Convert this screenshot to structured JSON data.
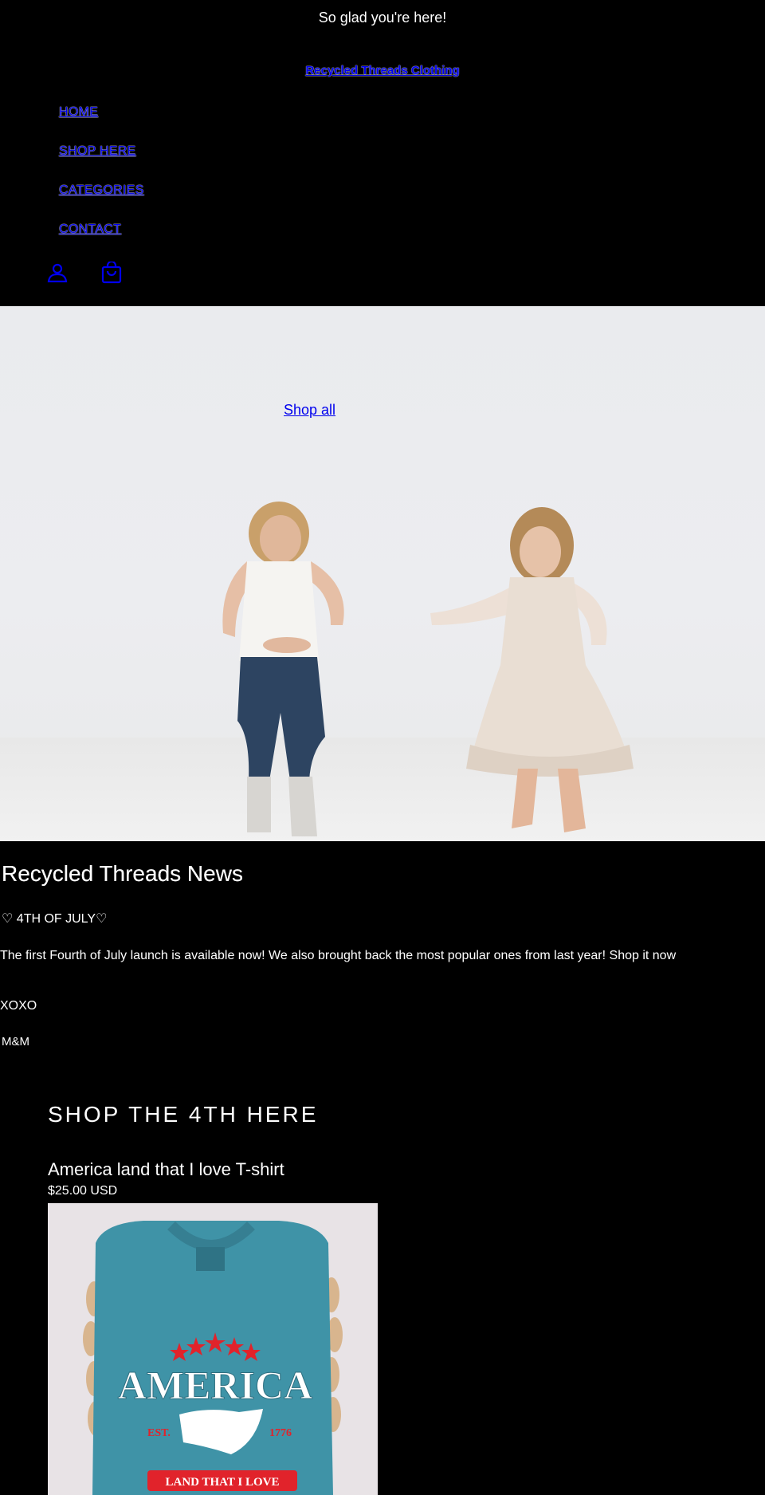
{
  "announcement": "So glad you're here!",
  "brand": "Recycled Threads Clothing",
  "nav": [
    {
      "label": "HOME"
    },
    {
      "label": "SHOP HERE"
    },
    {
      "label": "CATEGORIES"
    },
    {
      "label": "CONTACT"
    }
  ],
  "icons": [
    "account-icon",
    "cart-icon"
  ],
  "hero": {
    "link": "Shop all"
  },
  "news": {
    "title": "Recycled Threads News",
    "subtitle": "♡ 4TH OF JULY♡",
    "body": "The first Fourth of July launch is available now! We also brought back the most popular ones from last year! Shop it now",
    "signoff": "XOXO",
    "signature": "M&M"
  },
  "featured": {
    "title": "SHOP THE 4TH HERE",
    "product": {
      "name": "America land that I love T-shirt",
      "price": "$25.00 USD",
      "shirt_text": {
        "main": "AMERICA",
        "est": "EST.",
        "year": "1776",
        "banner": "LAND THAT I LOVE"
      }
    }
  },
  "colors": {
    "background": "#000000",
    "link": "#0000ee",
    "shirt": "#3f93a7",
    "accent_red": "#e1232b"
  }
}
